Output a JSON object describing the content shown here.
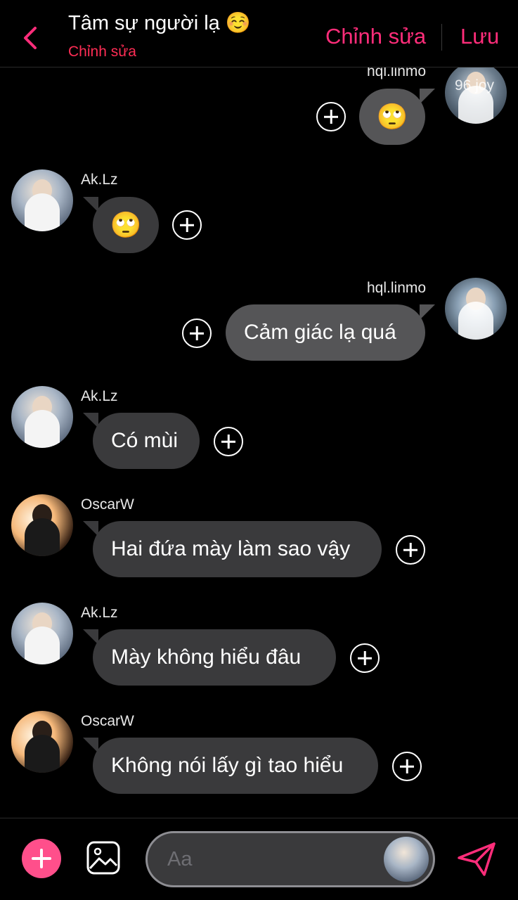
{
  "header": {
    "title": "Tâm sự người lạ ☺️",
    "subtitle": "Chỉnh sửa",
    "edit_label": "Chỉnh sửa",
    "save_label": "Lưu"
  },
  "messages": [
    {
      "user": "hql.linmo",
      "text": "🙄",
      "side": "right",
      "avatar_overlay": "96 joy"
    },
    {
      "user": "Ak.Lz",
      "text": "🙄",
      "side": "left"
    },
    {
      "user": "hql.linmo",
      "text": "Cảm giác lạ quá",
      "side": "right"
    },
    {
      "user": "Ak.Lz",
      "text": "Có mùi",
      "side": "left"
    },
    {
      "user": "OscarW",
      "text": "Hai đứa mày làm sao vậy",
      "side": "left"
    },
    {
      "user": "Ak.Lz",
      "text": "Mày không hiểu đâu",
      "side": "left"
    },
    {
      "user": "OscarW",
      "text": "Không nói lấy gì tao hiểu",
      "side": "left"
    }
  ],
  "composer": {
    "placeholder": "Aa"
  },
  "colors": {
    "accent": "#ff2d7a",
    "subtitle": "#ff2d55",
    "incoming_bubble": "#3a3a3c",
    "outgoing_bubble": "#555557",
    "add_button": "#ff4f8b"
  },
  "icons": {
    "back": "chevron-left-icon",
    "react": "plus-circle-icon",
    "add": "plus-icon",
    "image": "image-icon",
    "send": "paper-plane-icon"
  }
}
